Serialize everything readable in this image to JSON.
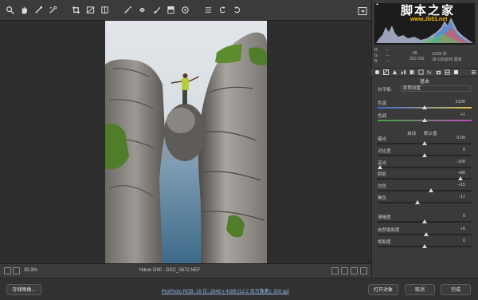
{
  "toolbar": {
    "icons": [
      "zoom-icon",
      "hand-icon",
      "white-balance-icon",
      "color-sampler-icon",
      "crop-icon",
      "straighten-icon",
      "transform-icon",
      "spot-removal-icon",
      "redeye-icon",
      "adjustment-brush-icon",
      "graduated-filter-icon",
      "radial-filter-icon",
      "preferences-icon",
      "rotate-left-icon",
      "rotate-right-icon"
    ]
  },
  "watermark": {
    "title": "脚本之家",
    "url": "www.Jb51.net"
  },
  "info": {
    "r_label": "R:",
    "r_val": "---",
    "g_label": "G:",
    "g_val": "---",
    "b_label": "B:",
    "b_val": "---",
    "aperture": "f/8",
    "shutter": "1/200 秒",
    "iso": "ISO 250",
    "lens": "18-105@38 毫米"
  },
  "panel": {
    "title": "基本",
    "wb_label": "白平衡:",
    "wb_value": "原照设置",
    "auto": "自动",
    "default": "默认值",
    "sliders": [
      {
        "label": "色温",
        "value": "5100",
        "pos": 0.5
      },
      {
        "label": "色调",
        "value": "+1",
        "pos": 0.5
      },
      {
        "label": "曝光",
        "value": "0.00",
        "pos": 0.5
      },
      {
        "label": "对比度",
        "value": "0",
        "pos": 0.5
      },
      {
        "label": "高光",
        "value": "-100",
        "pos": 0.0
      },
      {
        "label": "阴影",
        "value": "+80",
        "pos": 0.9
      },
      {
        "label": "白色",
        "value": "+15",
        "pos": 0.57
      },
      {
        "label": "黑色",
        "value": "-17",
        "pos": 0.42
      },
      {
        "label": "清晰度",
        "value": "0",
        "pos": 0.5
      },
      {
        "label": "自然饱和度",
        "value": "+5",
        "pos": 0.52
      },
      {
        "label": "饱和度",
        "value": "0",
        "pos": 0.5
      }
    ]
  },
  "bottombar": {
    "zoom": "30.3%",
    "filename": "Nikon D90 - DSC_0672.NEF"
  },
  "footer": {
    "save": "存储图像...",
    "workflow": "ProPhoto RGB; 16 位; 2848 x 4288 (12.2 百万像素); 300 ppi",
    "open": "打开对象",
    "cancel": "取消",
    "done": "完成"
  }
}
